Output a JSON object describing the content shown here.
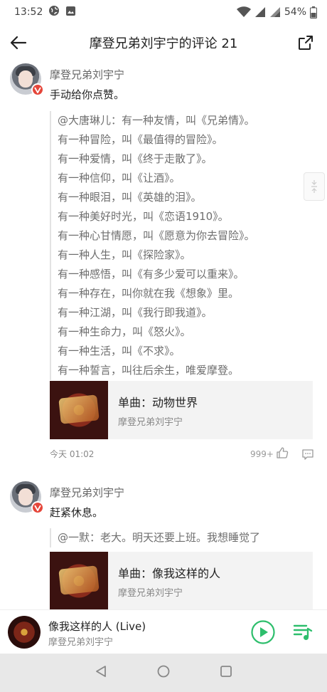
{
  "status_bar": {
    "time": "13:52",
    "battery": "54%"
  },
  "header": {
    "title": "摩登兄弟刘宇宁的评论 21"
  },
  "comments": [
    {
      "username": "摩登兄弟刘宇宁",
      "content": "手动给你点赞。",
      "quote_lines": [
        "@大唐琳儿：有一种友情，叫《兄弟情》。",
        "有一种冒险，叫《最值得的冒险》。",
        "有一种爱情，叫《终于走散了》。",
        "有一种信仰，叫《让酒》。",
        "有一种眼泪，叫《英雄的泪》。",
        "有一种美好时光，叫《恋语1910》。",
        "有一种心甘情愿，叫《愿意为你去冒险》。",
        "有一种人生，叫《探险家》。",
        "有一种感悟，叫《有多少爱可以重来》。",
        "有一种存在，叫你就在我《想象》里。",
        "有一种江湖，叫《我行即我道》。",
        "有一种生命力，叫《怒火》。",
        "有一种生活，叫《不求》。",
        "有一种誓言，叫往后余生，唯爱摩登。"
      ],
      "song": {
        "name": "单曲：动物世界",
        "artist": "摩登兄弟刘宇宁"
      },
      "time": "今天 01:02",
      "likes": "999+"
    },
    {
      "username": "摩登兄弟刘宇宁",
      "content": "赶紧休息。",
      "quote_lines": [
        "@一默：老大。明天还要上班。我想睡觉了"
      ],
      "song": {
        "name": "单曲：像我这样的人",
        "artist": "摩登兄弟刘宇宁"
      }
    }
  ],
  "player": {
    "title": "像我这样的人 (Live)",
    "artist": "摩登兄弟刘宇宁"
  },
  "colors": {
    "accent": "#2dbe6c",
    "verified": "#e5463a"
  }
}
